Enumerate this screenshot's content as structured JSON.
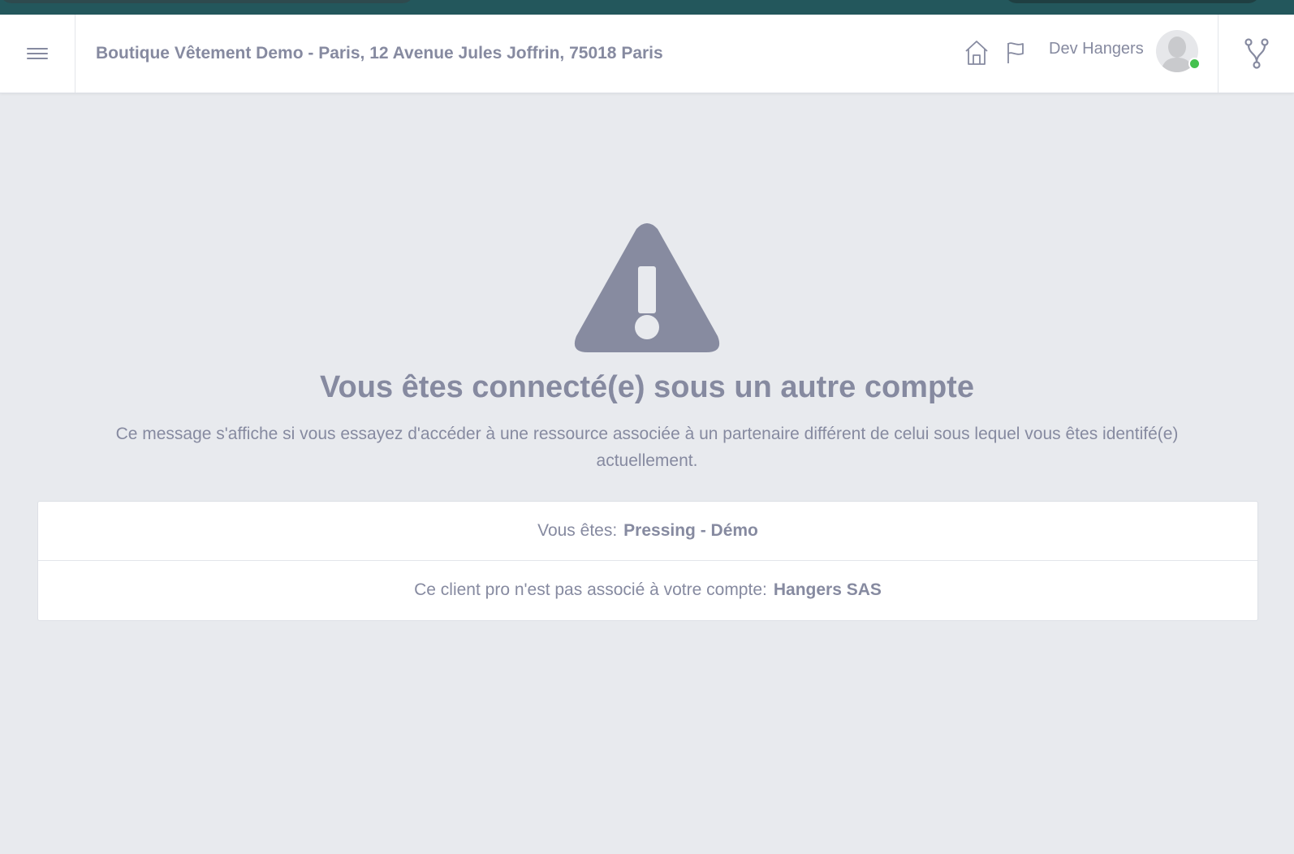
{
  "header": {
    "store_title": "Boutique Vêtement Demo - Paris, 12 Avenue Jules Joffrin, 75018 Paris",
    "user_name": "Dev Hangers",
    "icons": [
      "menu-icon",
      "home-icon",
      "flag-icon",
      "avatar",
      "branch-icon"
    ],
    "status_color": "#44c14e"
  },
  "main": {
    "title": "Vous êtes connecté(e) sous un autre compte",
    "description": "Ce message s'affiche si vous essayez d'accéder à une ressource associée à un partenaire différent de celui sous lequel vous êtes identifé(e) actuellement.",
    "warning_icon": "warning-icon",
    "rows": [
      {
        "label": "Vous êtes:",
        "value": "Pressing - Démo"
      },
      {
        "label": "Ce client pro n'est pas associé à votre compte:",
        "value": "Hangers SAS"
      }
    ]
  },
  "colors": {
    "background": "#e8eaee",
    "text": "#868aa0",
    "topbar": "#23575c"
  }
}
